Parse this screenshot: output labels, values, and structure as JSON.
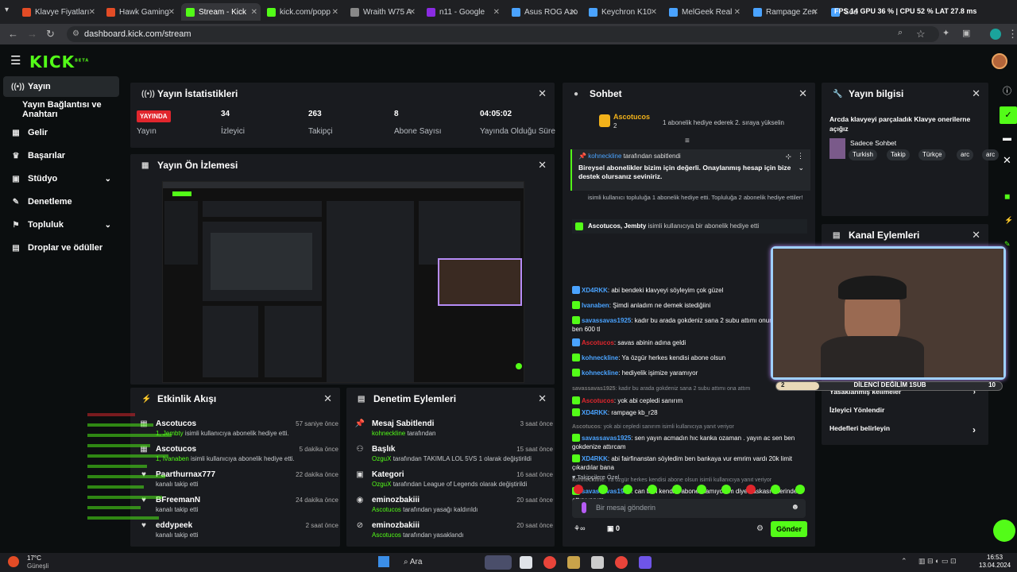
{
  "browser": {
    "tabs": [
      {
        "label": "Klavye Fiyatları",
        "color": "#e34c26"
      },
      {
        "label": "Hawk Gaming",
        "color": "#e34c26"
      },
      {
        "label": "Stream - Kick",
        "color": "#53fc18"
      },
      {
        "label": "kick.com/popp",
        "color": "#53fc18"
      },
      {
        "label": "Wraith W75 A",
        "color": "#888888"
      },
      {
        "label": "n11 - Google",
        "color": "#8a2be2"
      },
      {
        "label": "Asus ROG Azo",
        "color": "#4aa3ff"
      },
      {
        "label": "Keychron K10",
        "color": "#4aa3ff"
      },
      {
        "label": "MelGeek Real",
        "color": "#4aa3ff"
      },
      {
        "label": "Rampage Zen",
        "color": "#4aa3ff"
      },
      {
        "label": "Sed Haber",
        "color": "#4aa3ff"
      }
    ],
    "url": "dashboard.kick.com/stream",
    "overlay": "FPS 14 GPU 36 % | CPU 52 % LAT 27.8 ms"
  },
  "app": {
    "logo": "KICK",
    "logo_sup": "BETA",
    "sidebar": [
      {
        "label": "Yayın",
        "icon": "broadcast-icon",
        "active": true
      },
      {
        "label": "Yayın Bağlantısı ve Anahtarı",
        "icon": "",
        "active": false
      },
      {
        "label": "Gelir",
        "icon": "revenue-icon",
        "active": false
      },
      {
        "label": "Başarılar",
        "icon": "trophy-icon",
        "active": false
      },
      {
        "label": "Stüdyo",
        "icon": "studio-icon",
        "active": false,
        "chevron": true
      },
      {
        "label": "Denetleme",
        "icon": "wrench-icon",
        "active": false
      },
      {
        "label": "Topluluk",
        "icon": "community-icon",
        "active": false,
        "chevron": true
      },
      {
        "label": "Droplar ve ödüller",
        "icon": "gift-icon",
        "active": false
      }
    ]
  },
  "stats": {
    "title": "Yayın İstatistikleri",
    "live_badge": "YAYINDA",
    "items": [
      {
        "value": "",
        "label": "Yayın"
      },
      {
        "value": "34",
        "label": "İzleyici"
      },
      {
        "value": "263",
        "label": "Takipçi"
      },
      {
        "value": "8",
        "label": "Abone Sayısı"
      },
      {
        "value": "04:05:02",
        "label": "Yayında Olduğu Süre"
      }
    ]
  },
  "preview": {
    "title": "Yayın Ön İzlemesi"
  },
  "activity": {
    "title": "Etkinlik Akışı",
    "events": [
      {
        "name": "Ascotucos",
        "desc_hl": "1, Jembty",
        "desc": " isimli kullanıcıya abonelik hediye etti.",
        "time": "57 saniye önce",
        "icon": "gift-icon"
      },
      {
        "name": "Ascotucos",
        "desc_hl": "1, Ivanaben",
        "desc": " isimli kullanıcıya abonelik hediye etti.",
        "time": "5 dakika önce",
        "icon": "gift-icon"
      },
      {
        "name": "Paarthurnax777",
        "desc_hl": "",
        "desc": "kanalı takip etti",
        "time": "22 dakika önce",
        "icon": "heart-icon"
      },
      {
        "name": "BFreemanN",
        "desc_hl": "",
        "desc": "kanalı takip etti",
        "time": "24 dakika önce",
        "icon": "heart-icon"
      },
      {
        "name": "eddypeek",
        "desc_hl": "",
        "desc": "kanalı takip etti",
        "time": "2 saat önce",
        "icon": "heart-icon"
      }
    ]
  },
  "moderation": {
    "title": "Denetim Eylemleri",
    "items": [
      {
        "name": "Mesaj Sabitlendi",
        "hl": "kohneckline",
        "desc": " tarafından",
        "time": "3 saat önce",
        "icon": "pin-icon"
      },
      {
        "name": "Başlık",
        "hl": "OzguX",
        "desc": " tarafından TAKIMLA LOL 5VS 1 olarak değiştirildi",
        "time": "15 saat önce",
        "icon": "users-icon"
      },
      {
        "name": "Kategori",
        "hl": "OzguX",
        "desc": " tarafından League of Legends olarak değiştirildi",
        "time": "16 saat önce",
        "icon": "category-icon"
      },
      {
        "name": "eminozbakiii",
        "hl": "Ascotucos",
        "desc": " tarafından yasağı kaldırıldı",
        "time": "20 saat önce",
        "icon": "unban-icon"
      },
      {
        "name": "eminozbakiii",
        "hl": "Ascotucos",
        "desc": " tarafından yasaklandı",
        "time": "20 saat önce",
        "icon": "ban-icon"
      }
    ]
  },
  "chat": {
    "title": "Sohbet",
    "top_user": "Ascotucos",
    "top_count": "2",
    "top_note": "1 abonelik hediye ederek 2. sıraya yükselin",
    "pinned_by": "kohneckline",
    "pinned_suffix": " tarafından sabitlendi",
    "pinned_text": "Bireysel abonelikler bizim için değerli. Onaylanmış hesap için bize destek olursanız seviniriz.",
    "gift_note": "isimli kullanıcı topluluğa 1 abonelik hediye etti. Topluluğa 2 abonelik hediye ettiler!",
    "gift_line": "Ascotucos, Jembty",
    "gift_line_rest": " isimli kullanıcıya bir abonelik hediye etti",
    "messages": [
      {
        "user": "XD4RKK",
        "color": "#4aa3ff",
        "text": ": abi bendeki klavyeyi söyleyim çok güzel"
      },
      {
        "user": "Ivanaben",
        "color": "#4aa3ff",
        "text": ": Şimdi anladım ne demek istediğiini"
      },
      {
        "user": "savassavas1925",
        "color": "#4aa3ff",
        "text": ": kadır bu arada gokdeniz sana 2 subu attımı onun ibanına ben 600 tl"
      },
      {
        "user": "Ascotucos",
        "color": "#e1262d",
        "text": ": savas abinin adına geldi"
      },
      {
        "user": "kohneckline",
        "color": "#4aa3ff",
        "text": ": Ya özgür herkes kendisi abone olsun"
      },
      {
        "user": "kohneckline",
        "color": "#4aa3ff",
        "text": ": hediyelik işimize yaramıyor"
      },
      {
        "user": "savassavas1925",
        "color": "#777777",
        "text": ": kadır bu arada gokdeniz sana 2 subu attımı ona attım"
      },
      {
        "user": "Ascotucos",
        "color": "#e1262d",
        "text": ": yok abi cepledi sanırım"
      },
      {
        "user": "XD4RKK",
        "color": "#4aa3ff",
        "text": ": rampage kb_r28"
      },
      {
        "user": "Ascotucos",
        "color": "#777777",
        "text": ": yok abi cepledi sanırım isimli kullanıcıya yanıt veriyor"
      },
      {
        "user": "savassavas1925",
        "color": "#4aa3ff",
        "text": ": sen yayın acmadın hıc kanka ozaman . yayın ac sen ben gokdenize attırcam"
      },
      {
        "user": "XD4RKK",
        "color": "#4aa3ff",
        "text": ": abi fairfinanstan söyledim ben bankaya vur emrim vardı 20k limit çıkardılar bana"
      },
      {
        "user": "kohneckline",
        "color": "#777777",
        "text": ": Ya özgür herkes kendisi abone olsun isimli kullanıcıya yanıt veriyor"
      },
      {
        "user": "savassavas1925",
        "color": "#4aa3ff",
        "text": ": can ben kendim abone olamıyorum diye baskası uzerinden attınıyorum"
      }
    ],
    "followers_only": "Takipçilere Özel",
    "input_placeholder": "Bir mesaj gönderin",
    "viewers": "0",
    "send": "Gönder"
  },
  "info": {
    "title": "Yayın bilgisi",
    "stream_title": "Arcda klavyeyi parçaladık Klavye onerilerne açığız",
    "chat_mode": "Sadece Sohbet",
    "tags": [
      "Turkish",
      "Takip",
      "Türkçe",
      "arc",
      "arc"
    ]
  },
  "actions": {
    "title": "Kanal Eylemleri",
    "items": [
      "Yasaklanmış kelimeler",
      "İzleyici Yönlendir",
      "Hedefleri belirleyin"
    ],
    "webcam_banner": "DİLENCİ DEĞİLİM 1SUB",
    "webcam_count_left": "2",
    "webcam_count_right": "10"
  },
  "taskbar": {
    "weather_temp": "17°C",
    "weather_text": "Güneşli",
    "search": "Ara",
    "time": "16:53",
    "date": "13.04.2024"
  }
}
